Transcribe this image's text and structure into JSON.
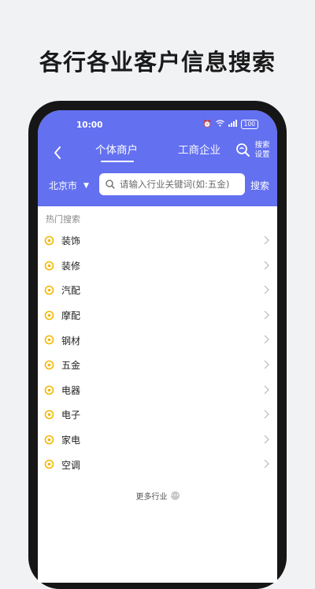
{
  "headline": "各行各业客户信息搜索",
  "status_bar": {
    "time": "10:00",
    "battery": "100"
  },
  "tabs": [
    {
      "label": "个体商户",
      "active": true
    },
    {
      "label": "工商企业",
      "active": false
    }
  ],
  "settings": {
    "line1": "搜索",
    "line2": "设置"
  },
  "search": {
    "city": "北京市",
    "placeholder": "请输入行业关键词(如:五金)",
    "button_label": "搜索"
  },
  "hot_search": {
    "title": "热门搜索",
    "items": [
      {
        "label": "装饰"
      },
      {
        "label": "装修"
      },
      {
        "label": "汽配"
      },
      {
        "label": "摩配"
      },
      {
        "label": "钢材"
      },
      {
        "label": "五金"
      },
      {
        "label": "电器"
      },
      {
        "label": "电子"
      },
      {
        "label": "家电"
      },
      {
        "label": "空调"
      }
    ]
  },
  "more_label": "更多行业",
  "colors": {
    "header": "#6370f0",
    "item_icon": "#f2b705",
    "background": "#f1f2f4"
  }
}
